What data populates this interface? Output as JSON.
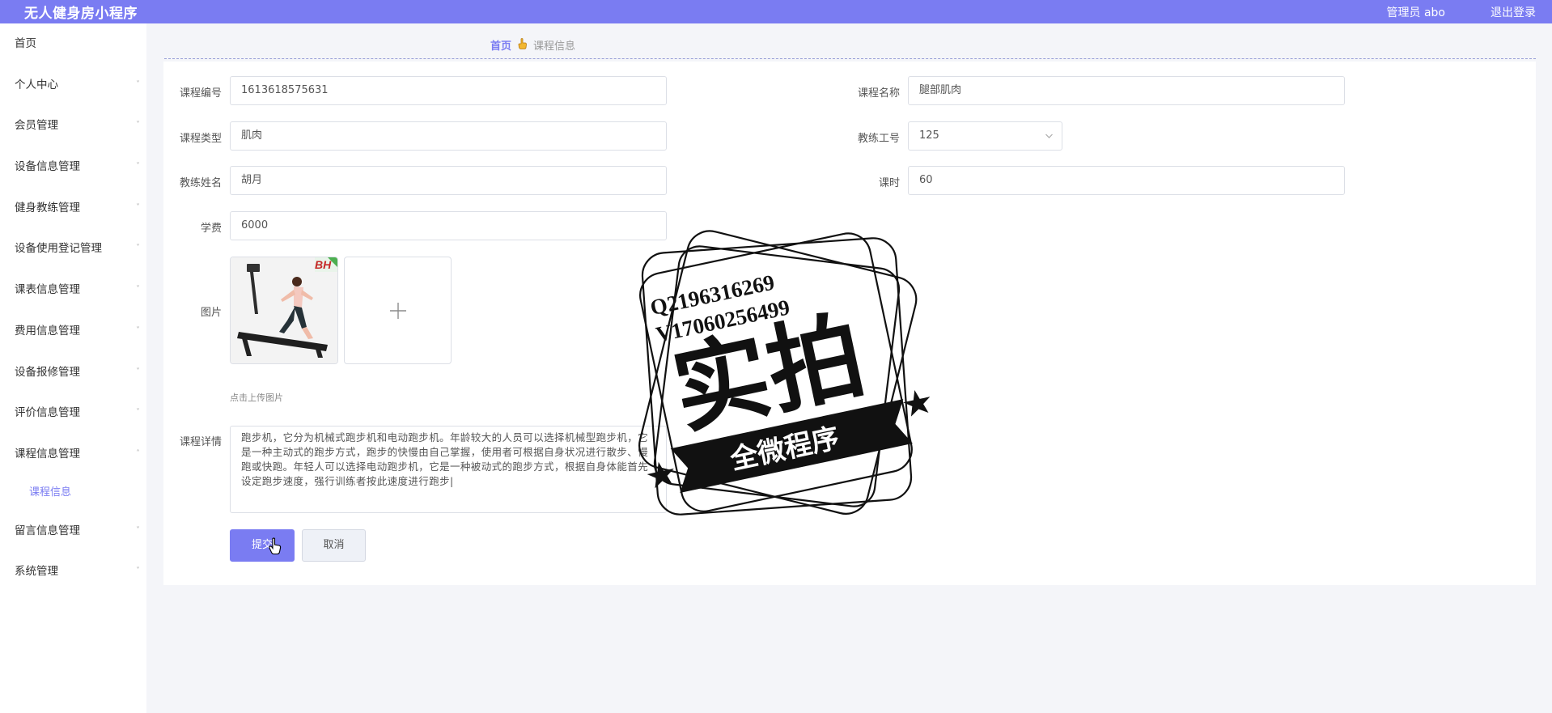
{
  "header": {
    "title": "无人健身房小程序",
    "admin": "管理员 abo",
    "logout": "退出登录"
  },
  "sidebar": {
    "items": [
      {
        "label": "首页",
        "chevron": false
      },
      {
        "label": "个人中心",
        "chevron": true
      },
      {
        "label": "会员管理",
        "chevron": true
      },
      {
        "label": "设备信息管理",
        "chevron": true
      },
      {
        "label": "健身教练管理",
        "chevron": true
      },
      {
        "label": "设备使用登记管理",
        "chevron": true
      },
      {
        "label": "课表信息管理",
        "chevron": true
      },
      {
        "label": "费用信息管理",
        "chevron": true
      },
      {
        "label": "设备报修管理",
        "chevron": true
      },
      {
        "label": "评价信息管理",
        "chevron": true
      },
      {
        "label": "课程信息管理",
        "chevron": true
      },
      {
        "label": "留言信息管理",
        "chevron": true
      },
      {
        "label": "系统管理",
        "chevron": true
      }
    ],
    "submenu": {
      "label": "课程信息"
    },
    "chev_down": "˅",
    "chev_up": "˄"
  },
  "breadcrumb": {
    "home": "首页",
    "sep_icon": "finger-pointing-icon",
    "current": "课程信息"
  },
  "form": {
    "course_id": {
      "label": "课程编号",
      "value": "1613618575631"
    },
    "course_name": {
      "label": "课程名称",
      "value": "腿部肌肉"
    },
    "course_type": {
      "label": "课程类型",
      "value": "肌肉"
    },
    "coach_id": {
      "label": "教练工号",
      "value": "125"
    },
    "coach_name": {
      "label": "教练姓名",
      "value": "胡月"
    },
    "hours": {
      "label": "课时",
      "value": "60"
    },
    "fee": {
      "label": "学费",
      "value": "6000"
    },
    "image": {
      "label": "图片",
      "hint": "点击上传图片",
      "thumb_badge": "BH"
    },
    "detail": {
      "label": "课程详情",
      "value": "跑步机，它分为机械式跑步机和电动跑步机。年龄较大的人员可以选择机械型跑步机，它是一种主动式的跑步方式，跑步的快慢由自己掌握，使用者可根据自身状况进行散步、慢跑或快跑。年轻人可以选择电动跑步机，它是一种被动式的跑步方式，根据自身体能首先设定跑步速度，强行训练者按此速度进行跑步|"
    },
    "submit": "提交",
    "cancel": "取消"
  },
  "watermark": {
    "line1": "Q2196316269",
    "line2": "V17060256499",
    "big": "实拍",
    "ribbon": "全微程序"
  },
  "colors": {
    "accent": "#7a7cf2",
    "sidebar_bg": "#ffffff",
    "page_bg": "#f4f5f9"
  }
}
